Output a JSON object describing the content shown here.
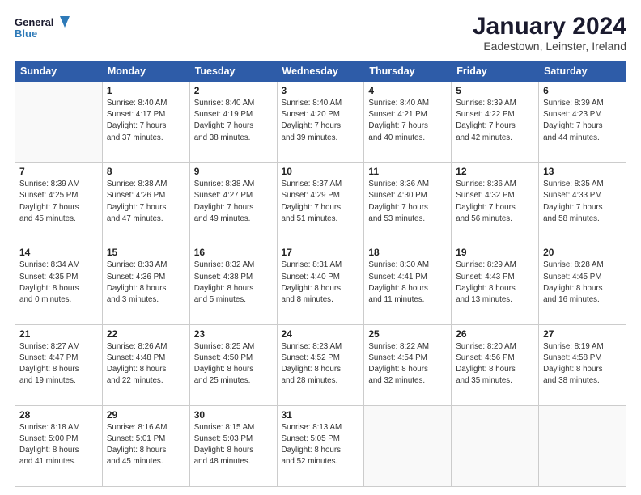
{
  "logo": {
    "line1": "General",
    "line2": "Blue"
  },
  "title": "January 2024",
  "location": "Eadestown, Leinster, Ireland",
  "days_of_week": [
    "Sunday",
    "Monday",
    "Tuesday",
    "Wednesday",
    "Thursday",
    "Friday",
    "Saturday"
  ],
  "weeks": [
    [
      {
        "day": "",
        "info": ""
      },
      {
        "day": "1",
        "info": "Sunrise: 8:40 AM\nSunset: 4:17 PM\nDaylight: 7 hours\nand 37 minutes."
      },
      {
        "day": "2",
        "info": "Sunrise: 8:40 AM\nSunset: 4:19 PM\nDaylight: 7 hours\nand 38 minutes."
      },
      {
        "day": "3",
        "info": "Sunrise: 8:40 AM\nSunset: 4:20 PM\nDaylight: 7 hours\nand 39 minutes."
      },
      {
        "day": "4",
        "info": "Sunrise: 8:40 AM\nSunset: 4:21 PM\nDaylight: 7 hours\nand 40 minutes."
      },
      {
        "day": "5",
        "info": "Sunrise: 8:39 AM\nSunset: 4:22 PM\nDaylight: 7 hours\nand 42 minutes."
      },
      {
        "day": "6",
        "info": "Sunrise: 8:39 AM\nSunset: 4:23 PM\nDaylight: 7 hours\nand 44 minutes."
      }
    ],
    [
      {
        "day": "7",
        "info": ""
      },
      {
        "day": "8",
        "info": "Sunrise: 8:38 AM\nSunset: 4:26 PM\nDaylight: 7 hours\nand 47 minutes."
      },
      {
        "day": "9",
        "info": "Sunrise: 8:38 AM\nSunset: 4:27 PM\nDaylight: 7 hours\nand 49 minutes."
      },
      {
        "day": "10",
        "info": "Sunrise: 8:37 AM\nSunset: 4:29 PM\nDaylight: 7 hours\nand 51 minutes."
      },
      {
        "day": "11",
        "info": "Sunrise: 8:36 AM\nSunset: 4:30 PM\nDaylight: 7 hours\nand 53 minutes."
      },
      {
        "day": "12",
        "info": "Sunrise: 8:36 AM\nSunset: 4:32 PM\nDaylight: 7 hours\nand 56 minutes."
      },
      {
        "day": "13",
        "info": "Sunrise: 8:35 AM\nSunset: 4:33 PM\nDaylight: 7 hours\nand 58 minutes."
      }
    ],
    [
      {
        "day": "14",
        "info": "Sunrise: 8:34 AM\nSunset: 4:35 PM\nDaylight: 8 hours\nand 0 minutes."
      },
      {
        "day": "15",
        "info": "Sunrise: 8:33 AM\nSunset: 4:36 PM\nDaylight: 8 hours\nand 3 minutes."
      },
      {
        "day": "16",
        "info": "Sunrise: 8:32 AM\nSunset: 4:38 PM\nDaylight: 8 hours\nand 5 minutes."
      },
      {
        "day": "17",
        "info": "Sunrise: 8:31 AM\nSunset: 4:40 PM\nDaylight: 8 hours\nand 8 minutes."
      },
      {
        "day": "18",
        "info": "Sunrise: 8:30 AM\nSunset: 4:41 PM\nDaylight: 8 hours\nand 11 minutes."
      },
      {
        "day": "19",
        "info": "Sunrise: 8:29 AM\nSunset: 4:43 PM\nDaylight: 8 hours\nand 13 minutes."
      },
      {
        "day": "20",
        "info": "Sunrise: 8:28 AM\nSunset: 4:45 PM\nDaylight: 8 hours\nand 16 minutes."
      }
    ],
    [
      {
        "day": "21",
        "info": "Sunrise: 8:27 AM\nSunset: 4:47 PM\nDaylight: 8 hours\nand 19 minutes."
      },
      {
        "day": "22",
        "info": "Sunrise: 8:26 AM\nSunset: 4:48 PM\nDaylight: 8 hours\nand 22 minutes."
      },
      {
        "day": "23",
        "info": "Sunrise: 8:25 AM\nSunset: 4:50 PM\nDaylight: 8 hours\nand 25 minutes."
      },
      {
        "day": "24",
        "info": "Sunrise: 8:23 AM\nSunset: 4:52 PM\nDaylight: 8 hours\nand 28 minutes."
      },
      {
        "day": "25",
        "info": "Sunrise: 8:22 AM\nSunset: 4:54 PM\nDaylight: 8 hours\nand 32 minutes."
      },
      {
        "day": "26",
        "info": "Sunrise: 8:20 AM\nSunset: 4:56 PM\nDaylight: 8 hours\nand 35 minutes."
      },
      {
        "day": "27",
        "info": "Sunrise: 8:19 AM\nSunset: 4:58 PM\nDaylight: 8 hours\nand 38 minutes."
      }
    ],
    [
      {
        "day": "28",
        "info": "Sunrise: 8:18 AM\nSunset: 5:00 PM\nDaylight: 8 hours\nand 41 minutes."
      },
      {
        "day": "29",
        "info": "Sunrise: 8:16 AM\nSunset: 5:01 PM\nDaylight: 8 hours\nand 45 minutes."
      },
      {
        "day": "30",
        "info": "Sunrise: 8:15 AM\nSunset: 5:03 PM\nDaylight: 8 hours\nand 48 minutes."
      },
      {
        "day": "31",
        "info": "Sunrise: 8:13 AM\nSunset: 5:05 PM\nDaylight: 8 hours\nand 52 minutes."
      },
      {
        "day": "",
        "info": ""
      },
      {
        "day": "",
        "info": ""
      },
      {
        "day": "",
        "info": ""
      }
    ]
  ],
  "week7_sunday": "Sunrise: 8:39 AM\nSunset: 4:25 PM\nDaylight: 7 hours\nand 45 minutes."
}
